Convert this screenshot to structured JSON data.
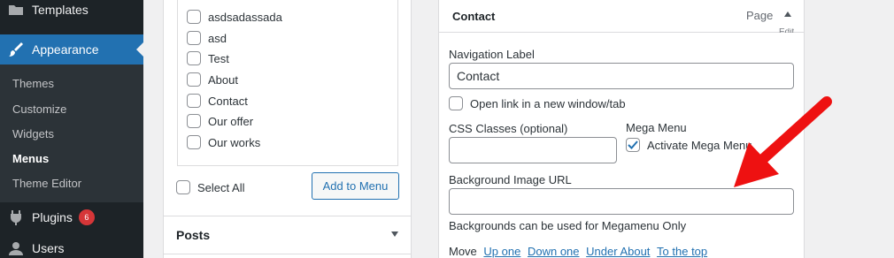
{
  "sidebar": {
    "templates": "Templates",
    "appearance": "Appearance",
    "submenu": [
      "Themes",
      "Customize",
      "Widgets",
      "Menus",
      "Theme Editor"
    ],
    "current": "Menus",
    "plugins": "Plugins",
    "plugins_badge": "6",
    "users": "Users"
  },
  "pages_box": {
    "items": [
      {
        "label": "asdsadassada",
        "checked": false
      },
      {
        "label": "asd",
        "checked": false
      },
      {
        "label": "Test",
        "checked": false
      },
      {
        "label": "About",
        "checked": false
      },
      {
        "label": "Contact",
        "checked": false
      },
      {
        "label": "Our offer",
        "checked": false
      },
      {
        "label": "Our works",
        "checked": false
      }
    ],
    "select_all": "Select All",
    "add_button": "Add to Menu",
    "next_section": "Posts"
  },
  "menu_item": {
    "title": "Contact",
    "type": "Page",
    "edit_link": "Edit",
    "nav_label_label": "Navigation Label",
    "nav_label_value": "Contact",
    "new_window_label": "Open link in a new window/tab",
    "new_window_checked": false,
    "css_classes_label": "CSS Classes (optional)",
    "css_classes_value": "",
    "mega_menu_label": "Mega Menu",
    "activate_mega_label": "Activate Mega Menu",
    "activate_mega_checked": true,
    "bg_image_label": "Background Image URL",
    "bg_image_value": "",
    "bg_help": "Backgrounds can be used for Megamenu Only",
    "move_label": "Move",
    "move_links": [
      "Up one",
      "Down one",
      "Under About",
      "To the top"
    ]
  },
  "colors": {
    "accent": "#2271b1",
    "sidebar_bg": "#1d2327",
    "badge": "#d63638",
    "annotation_arrow": "#ee1111"
  },
  "icons": {
    "templates": "folder-icon",
    "appearance": "paintbrush-icon",
    "plugins": "plug-icon",
    "users": "user-icon"
  }
}
